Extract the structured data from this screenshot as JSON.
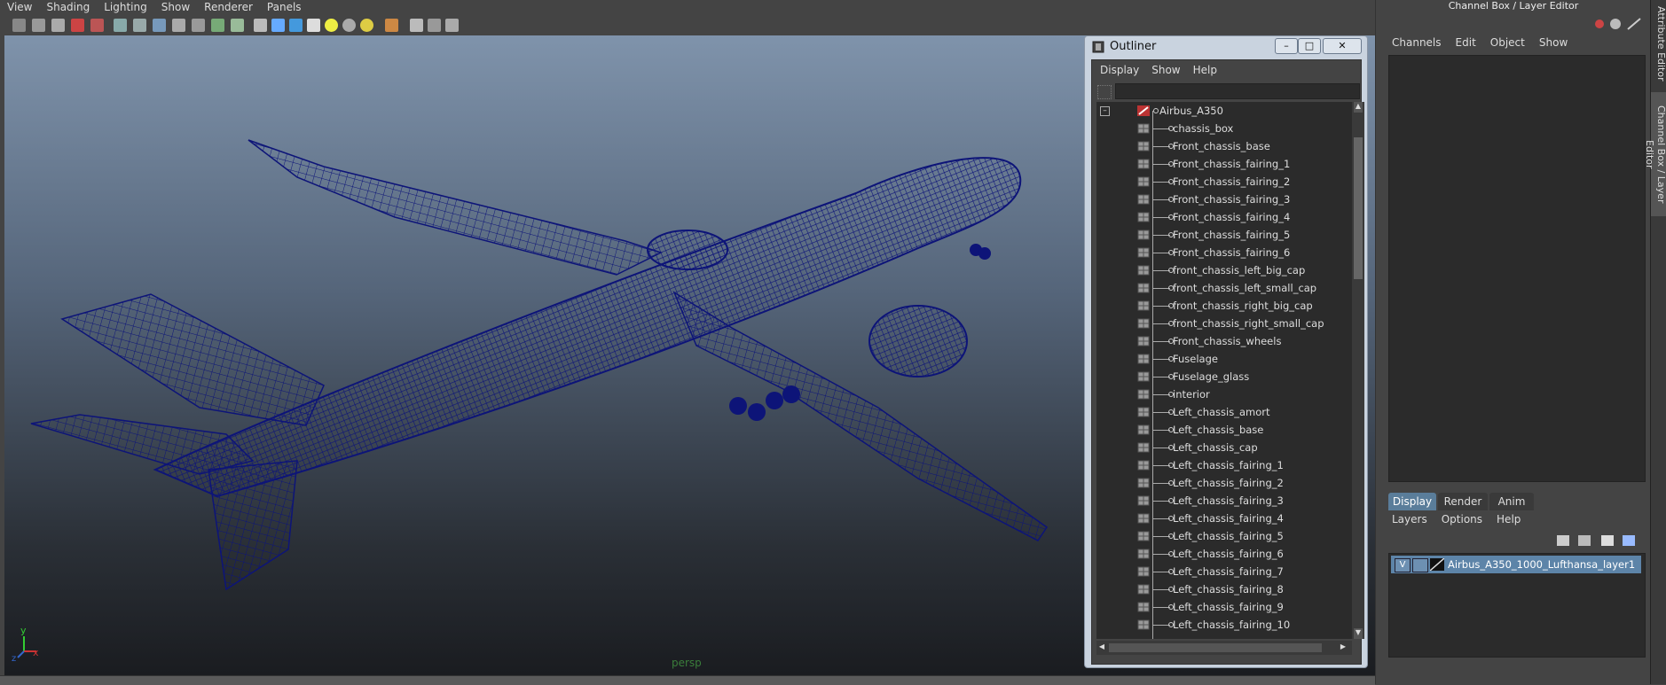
{
  "menu": [
    "View",
    "Shading",
    "Lighting",
    "Show",
    "Renderer",
    "Panels"
  ],
  "viewport": {
    "camera_label": "persp",
    "axis_y": "y",
    "axis_x": "x",
    "axis_z": "z"
  },
  "outliner": {
    "title": "Outliner",
    "menu": [
      "Display",
      "Show",
      "Help"
    ],
    "root": "Airbus_A350",
    "items": [
      "chassis_box",
      "Front_chassis_base",
      "Front_chassis_fairing_1",
      "Front_chassis_fairing_2",
      "Front_chassis_fairing_3",
      "Front_chassis_fairing_4",
      "Front_chassis_fairing_5",
      "Front_chassis_fairing_6",
      "front_chassis_left_big_cap",
      "front_chassis_left_small_cap",
      "front_chassis_right_big_cap",
      "front_chassis_right_small_cap",
      "Front_chassis_wheels",
      "Fuselage",
      "Fuselage_glass",
      "interior",
      "Left_chassis_amort",
      "Left_chassis_base",
      "Left_chassis_cap",
      "Left_chassis_fairing_1",
      "Left_chassis_fairing_2",
      "Left_chassis_fairing_3",
      "Left_chassis_fairing_4",
      "Left_chassis_fairing_5",
      "Left_chassis_fairing_6",
      "Left_chassis_fairing_7",
      "Left_chassis_fairing_8",
      "Left_chassis_fairing_9",
      "Left_chassis_fairing_10"
    ]
  },
  "channelbox": {
    "title": "Channel Box / Layer Editor",
    "menu": [
      "Channels",
      "Edit",
      "Object",
      "Show"
    ],
    "tabs": [
      "Display",
      "Render",
      "Anim"
    ],
    "layer_menu": [
      "Layers",
      "Options",
      "Help"
    ],
    "layer": {
      "visible": "V",
      "name": "Airbus_A350_1000_Lufthansa_layer1"
    }
  },
  "side_tabs": [
    "Attribute Editor",
    "Channel Box / Layer Editor"
  ],
  "colors": {
    "wireframe": "#0d1478",
    "selection": "#5d84a8"
  }
}
